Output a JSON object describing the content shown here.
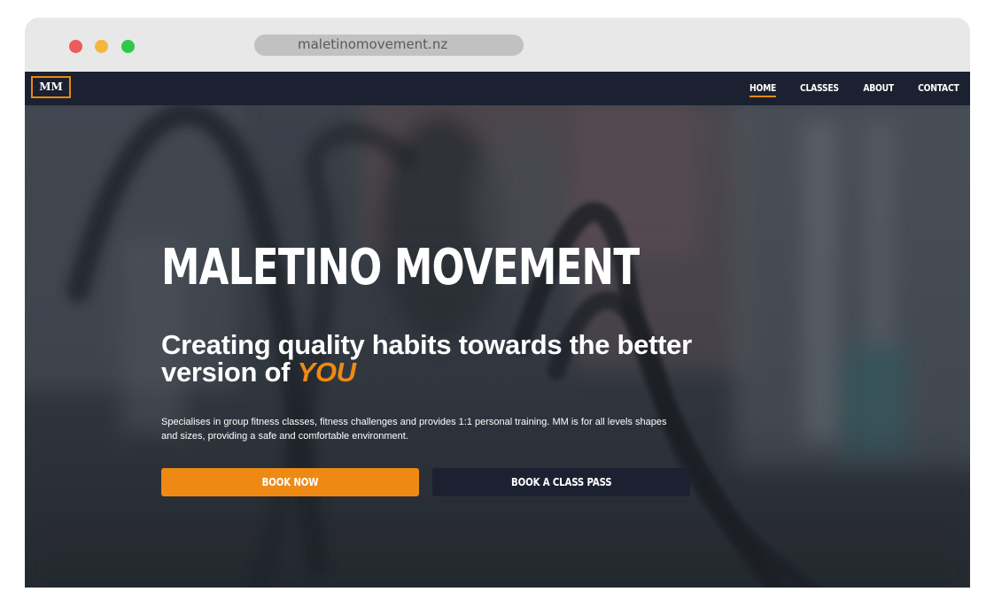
{
  "browser": {
    "url": "maletinomovement.nz"
  },
  "navbar": {
    "logo": "MM",
    "links": [
      {
        "label": "HOME",
        "active": true
      },
      {
        "label": "CLASSES",
        "active": false
      },
      {
        "label": "ABOUT",
        "active": false
      },
      {
        "label": "CONTACT",
        "active": false
      }
    ]
  },
  "hero": {
    "title": "MALETINO MOVEMENT",
    "tagline_main": "Creating quality habits towards the better version of ",
    "tagline_accent": "YOU",
    "description": "Specialises in group fitness classes, fitness challenges and provides 1:1 personal training. MM is for all levels shapes and sizes, providing a safe and comfortable environment.",
    "primary_button": "BOOK NOW",
    "secondary_button": "BOOK A CLASS PASS"
  },
  "colors": {
    "accent": "#ee8a14",
    "navbar": "#1b2130"
  }
}
